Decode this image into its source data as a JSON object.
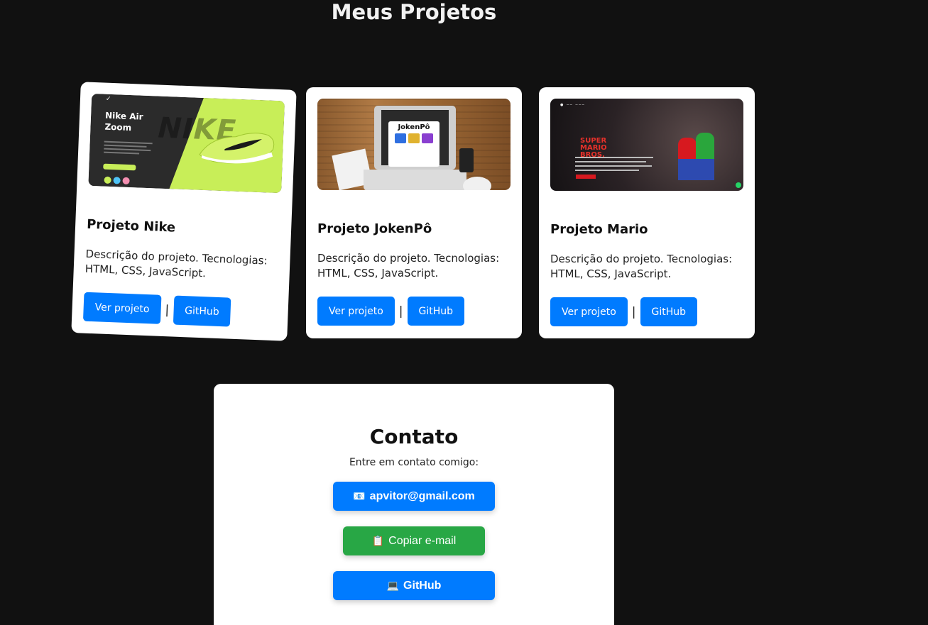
{
  "section_title": "Meus Projetos",
  "projects": [
    {
      "title": "Projeto Nike",
      "description": "Descrição do projeto. Tecnologias: HTML, CSS, JavaScript.",
      "view_label": "Ver projeto",
      "github_label": "GitHub",
      "thumb": {
        "heading": "Nike Air Zoom",
        "watermark": "NIKE"
      }
    },
    {
      "title": "Projeto JokenPô",
      "description": "Descrição do projeto. Tecnologias: HTML, CSS, JavaScript.",
      "view_label": "Ver projeto",
      "github_label": "GitHub",
      "thumb": {
        "heading": "JokenPô"
      }
    },
    {
      "title": "Projeto Mario",
      "description": "Descrição do projeto. Tecnologias: HTML, CSS, JavaScript.",
      "view_label": "Ver projeto",
      "github_label": "GitHub",
      "thumb": {
        "heading": "SUPER MARIO BROS."
      }
    }
  ],
  "separator": "|",
  "contact": {
    "title": "Contato",
    "lead": "Entre em contato comigo:",
    "email_label": "apvitor@gmail.com",
    "copy_label": "Copiar e-mail",
    "github_label": "GitHub"
  },
  "colors": {
    "background": "#111111",
    "primary": "#007bff",
    "success": "#28a745",
    "card": "#ffffff"
  },
  "icons": {
    "email": "email-icon",
    "copy": "clipboard-icon",
    "github": "laptop-icon"
  }
}
